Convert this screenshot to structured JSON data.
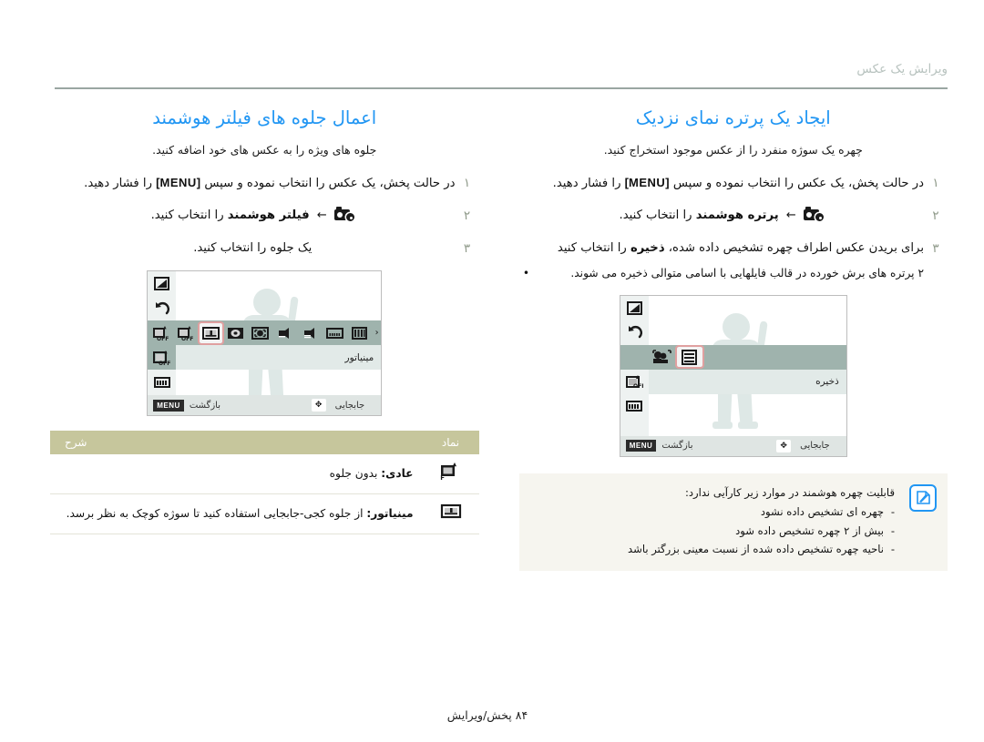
{
  "header": {
    "running_head": "ویرایش یک عکس"
  },
  "footer": {
    "section": "پخش/ویرایش",
    "page_number": "۸۴"
  },
  "columns": {
    "right": {
      "title": "ایجاد یک پرتره نمای نزدیک",
      "intro": "چهره یک سوژه منفرد را از عکس موجود استخراج کنید.",
      "steps": [
        {
          "num": "۱",
          "text_before": "در حالت پخش، یک عکس را انتخاب نموده و سپس",
          "kbd": "[MENU]",
          "text_after": "را فشار دهید."
        },
        {
          "num": "۲",
          "icon": "camera-gear-icon",
          "arrow": "←",
          "bold": "پرتره هوشمند",
          "text_after": "را انتخاب کنید."
        },
        {
          "num": "۳",
          "text_before": "برای بریدن عکس اطراف چهره تشخیص داده شده،",
          "bold": "ذخیره",
          "text_after": "را انتخاب کنید",
          "bullet": "۲ پرتره های برش خورده در قالب فایلهایی با اسامی متوالی ذخیره می شوند."
        }
      ],
      "lcd": {
        "rail_icons": [
          "crop-icon",
          "rotate-icon",
          "smart-portrait-icon",
          "smart-filter-icon",
          "resize-icon"
        ],
        "active_rail_index": 2,
        "menu_icons": [
          "smart-portrait-icon",
          "smart-portrait-off-icon",
          "save-icon"
        ],
        "selected_menu_index": 2,
        "label": "ذخیره",
        "menu_chip": "MENU",
        "back_label": "بازگشت",
        "move_label": "جابجایی",
        "dpad": "dpad-icon"
      },
      "note": {
        "icon": "note-pencil-icon",
        "lead": "قابلیت چهره هوشمند در موارد زیر کارآیی ندارد:",
        "items": [
          "چهره ای تشخیص داده نشود",
          "بیش از ۲ چهره تشخیص داده شود",
          "ناحیه چهره تشخیص داده شده از نسبت معینی بزرگتر باشد"
        ]
      }
    },
    "left": {
      "title": "اعمال جلوه های فیلتر هوشمند",
      "intro": "جلوه های ویژه را به عکس های خود اضافه کنید.",
      "steps": [
        {
          "num": "۱",
          "text_before": "در حالت پخش، یک عکس را انتخاب نموده و سپس",
          "kbd": "[MENU]",
          "text_after": "را فشار دهید."
        },
        {
          "num": "۲",
          "icon": "camera-gear-icon",
          "arrow": "←",
          "bold": "فیلتر هوشمند",
          "text_after": "را انتخاب کنید."
        },
        {
          "num": "۳",
          "text_before": "یک جلوه را انتخاب کنید."
        }
      ],
      "lcd": {
        "rail_icons": [
          "crop-icon",
          "rotate-icon",
          "smart-portrait-off-icon",
          "smart-filter-icon",
          "resize-icon"
        ],
        "active_rail_index": 3,
        "menu_icons": [
          "filter-normal-icon",
          "filter-off-icon",
          "miniature-icon",
          "vignetting-icon",
          "soft-focus-icon",
          "old-film-1-icon",
          "old-film-2-icon",
          "half-tone-icon",
          "sketch-icon"
        ],
        "selected_menu_index": 2,
        "label": "مینیاتور",
        "menu_chip": "MENU",
        "back_label": "بازگشت",
        "move_label": "جابجایی",
        "dpad": "dpad-icon"
      },
      "table": {
        "headers": {
          "symbol": "نماد",
          "description": "شرح"
        },
        "rows": [
          {
            "icon": "filter-normal-icon",
            "bold": "عادی:",
            "text": " بدون جلوه"
          },
          {
            "icon": "miniature-icon",
            "bold": "مینیاتور:",
            "text": " از جلوه کجی-جابجایی استفاده کنید تا سوژه کوچک به نظر برسد."
          }
        ]
      }
    }
  }
}
